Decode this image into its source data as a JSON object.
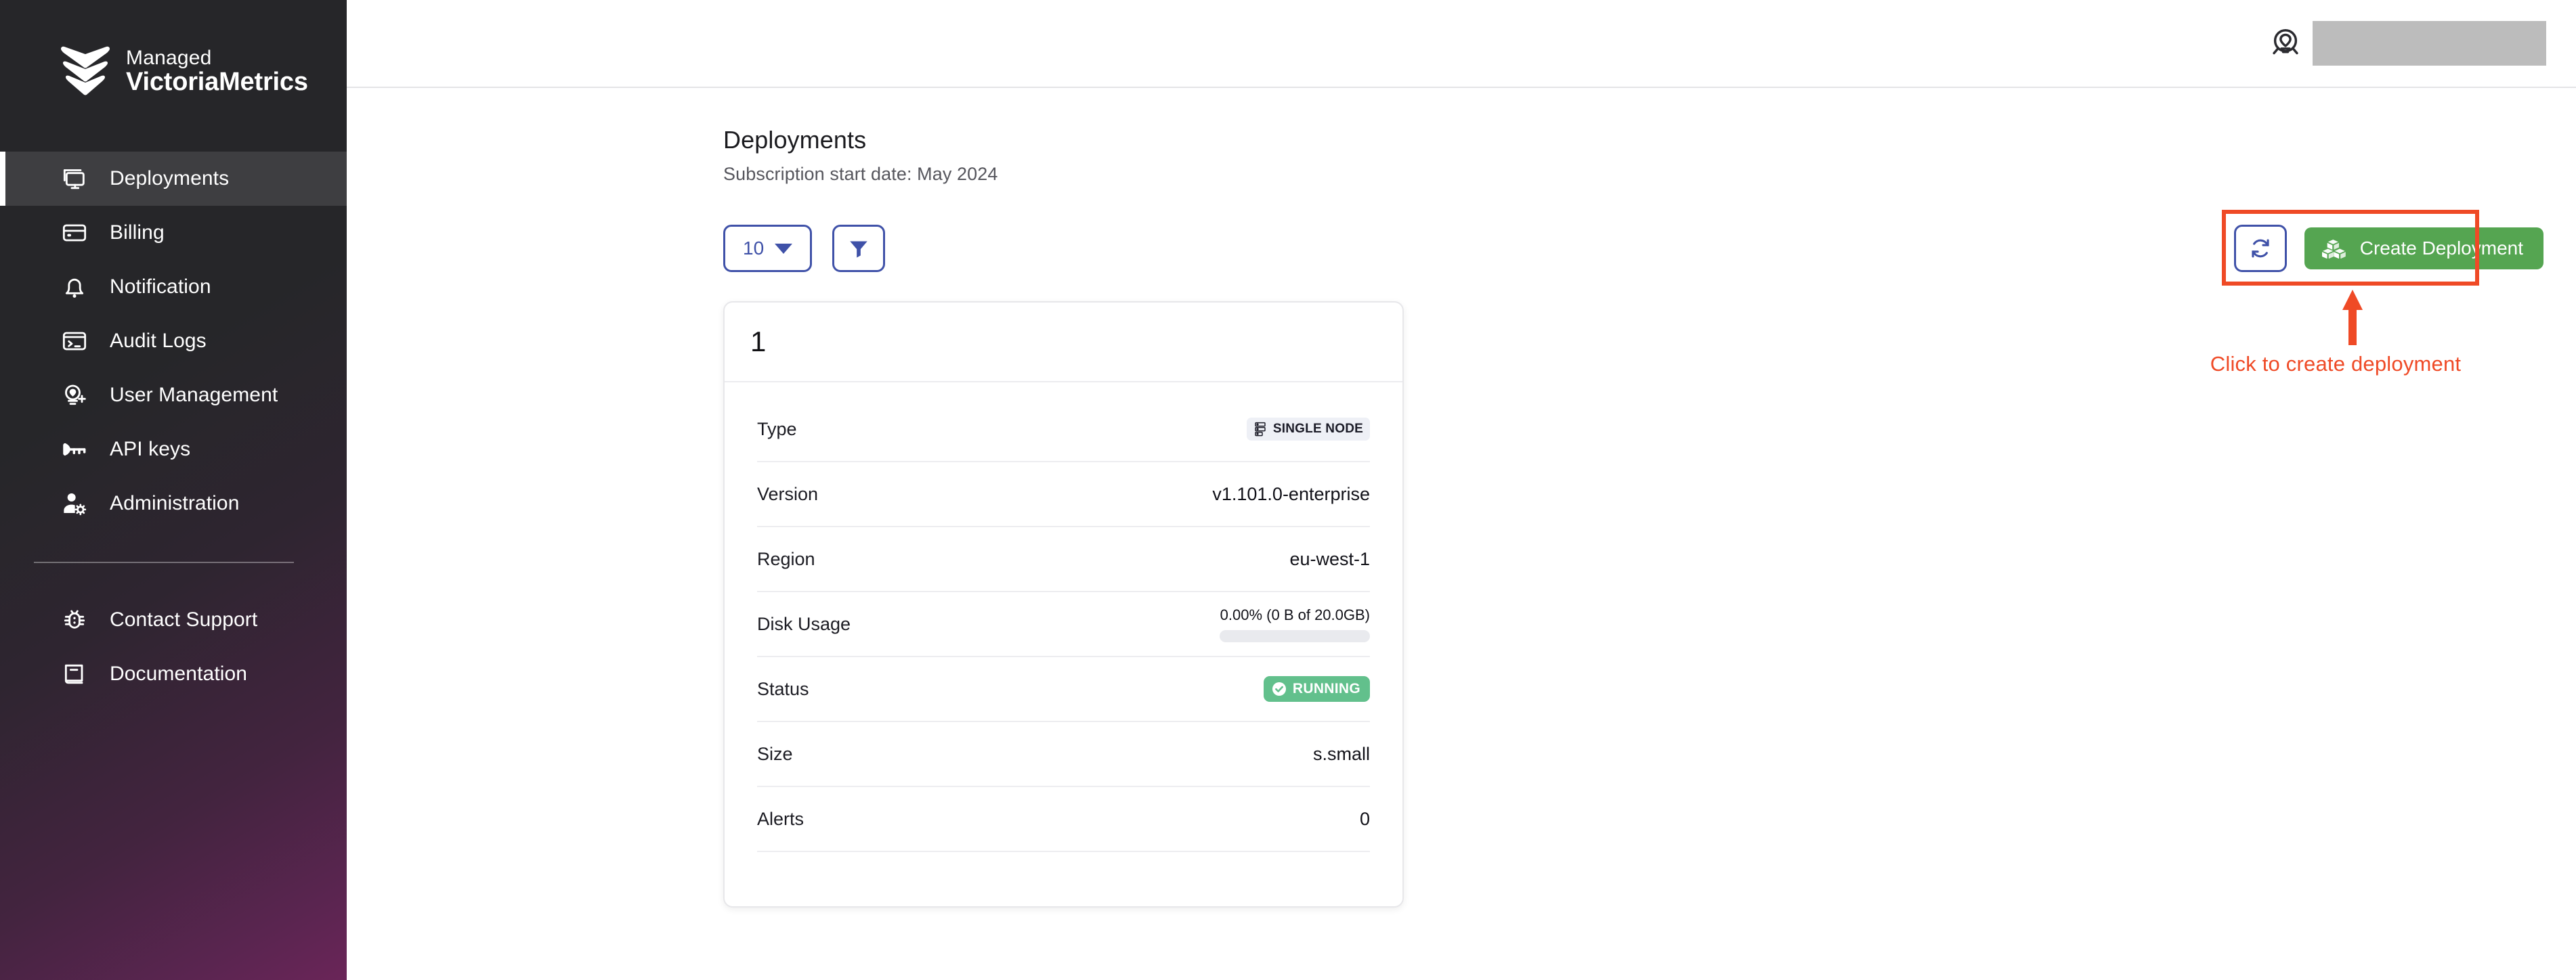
{
  "brand": {
    "line1": "Managed",
    "line2": "VictoriaMetrics"
  },
  "sidebar": {
    "items": [
      {
        "label": "Deployments",
        "icon": "monitor-icon",
        "active": true
      },
      {
        "label": "Billing",
        "icon": "credit-card-icon",
        "active": false
      },
      {
        "label": "Notification",
        "icon": "bell-icon",
        "active": false
      },
      {
        "label": "Audit Logs",
        "icon": "terminal-icon",
        "active": false
      },
      {
        "label": "User Management",
        "icon": "user-add-icon",
        "active": false
      },
      {
        "label": "API keys",
        "icon": "key-icon",
        "active": false
      },
      {
        "label": "Administration",
        "icon": "user-gear-icon",
        "active": false
      }
    ],
    "bottom_items": [
      {
        "label": "Contact Support",
        "icon": "bug-icon"
      },
      {
        "label": "Documentation",
        "icon": "book-icon"
      }
    ]
  },
  "topbar": {
    "account_icon": "account-shield-icon",
    "account_name_redacted": ""
  },
  "page": {
    "title": "Deployments",
    "subtitle": "Subscription start date: May 2024"
  },
  "toolbar": {
    "page_size_value": "10",
    "filter_icon": "funnel-icon",
    "refresh_icon": "refresh-icon",
    "create_label": "Create Deployment",
    "create_icon": "boxes-icon"
  },
  "annotation": {
    "text": "Click to create deployment",
    "color": "#ef4a26"
  },
  "deployment_card": {
    "title": "1",
    "rows": [
      {
        "label": "Type",
        "value": "SINGLE NODE",
        "kind": "badge-type",
        "icon": "server-icon"
      },
      {
        "label": "Version",
        "value": "v1.101.0-enterprise",
        "kind": "text"
      },
      {
        "label": "Region",
        "value": "eu-west-1",
        "kind": "text"
      },
      {
        "label": "Disk Usage",
        "value": "0.00% (0 B of 20.0GB)",
        "kind": "progress",
        "percent": 0
      },
      {
        "label": "Status",
        "value": "RUNNING",
        "kind": "badge-status",
        "icon": "check-circle-icon"
      },
      {
        "label": "Size",
        "value": "s.small",
        "kind": "text"
      },
      {
        "label": "Alerts",
        "value": "0",
        "kind": "text"
      }
    ]
  },
  "colors": {
    "accent_blue": "#3f51a8",
    "create_green": "#55a551",
    "status_green": "#62c08c",
    "annotation_red": "#ef4a26"
  }
}
